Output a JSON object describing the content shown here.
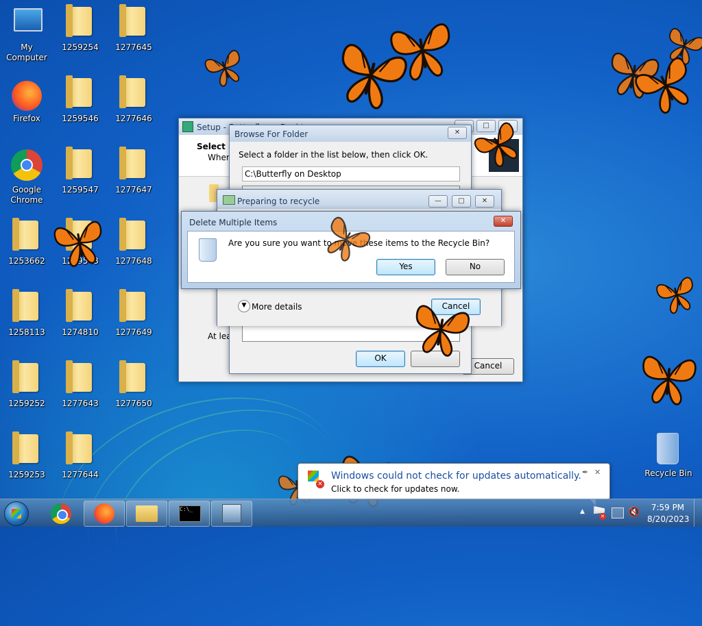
{
  "desktop": {
    "icons": [
      {
        "label": "My Computer",
        "icon": "computer-icon"
      },
      {
        "label": "1259254",
        "icon": "folder-icon"
      },
      {
        "label": "1277645",
        "icon": "folder-icon"
      },
      {
        "label": "Firefox",
        "icon": "firefox-icon"
      },
      {
        "label": "1259546",
        "icon": "folder-icon"
      },
      {
        "label": "1277646",
        "icon": "folder-icon"
      },
      {
        "label": "Google Chrome",
        "icon": "chrome-icon"
      },
      {
        "label": "1259547",
        "icon": "folder-icon"
      },
      {
        "label": "1277647",
        "icon": "folder-icon"
      },
      {
        "label": "1253662",
        "icon": "folder-icon"
      },
      {
        "label": "1259548",
        "icon": "folder-icon"
      },
      {
        "label": "1277648",
        "icon": "folder-icon"
      },
      {
        "label": "1258113",
        "icon": "folder-icon"
      },
      {
        "label": "1274810",
        "icon": "folder-icon"
      },
      {
        "label": "1277649",
        "icon": "folder-icon"
      },
      {
        "label": "1259252",
        "icon": "folder-icon"
      },
      {
        "label": "1277643",
        "icon": "folder-icon"
      },
      {
        "label": "1277650",
        "icon": "folder-icon"
      },
      {
        "label": "1259253",
        "icon": "folder-icon"
      },
      {
        "label": "1277644",
        "icon": "folder-icon"
      }
    ],
    "recycle_bin": {
      "label": "Recycle Bin"
    }
  },
  "setup_window": {
    "title": "Setup - Butterfly on Desktop",
    "heading": "Select D",
    "subheading": "Where",
    "at_least": "At leas",
    "cancel_label": "Cancel"
  },
  "browse_dialog": {
    "title": "Browse For Folder",
    "instruction": "Select a folder in the list below, then click OK.",
    "path_value": "C:\\Butterfly on Desktop",
    "ok_label": "OK"
  },
  "recycle_progress": {
    "title": "Preparing to recycle",
    "more_details": "More details",
    "cancel_label": "Cancel"
  },
  "delete_dialog": {
    "title": "Delete Multiple Items",
    "message": "Are you sure you want to move these items to the Recycle Bin?",
    "yes_label": "Yes",
    "no_label": "No"
  },
  "notification": {
    "title": "Windows could not check for updates automatically.",
    "body": "Click to check for updates now."
  },
  "taskbar": {
    "clock_time": "7:59 PM",
    "clock_date": "8/20/2023",
    "items": [
      "start-button",
      "chrome-taskbar",
      "firefox-taskbar",
      "explorer-taskbar",
      "cmd-taskbar",
      "setup-taskbar"
    ]
  },
  "colors": {
    "accent": "#1e395b",
    "link": "#1a4ea2",
    "butterfly": "#f07a12"
  }
}
